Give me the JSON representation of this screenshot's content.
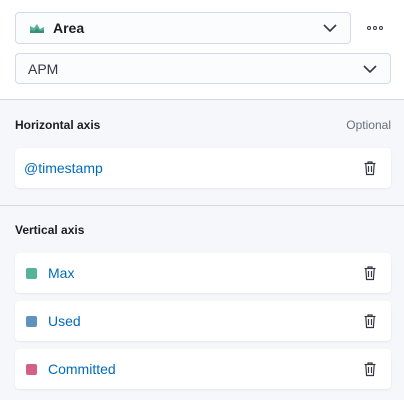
{
  "chart_type": {
    "label": "Area",
    "icon": "area-chart-icon"
  },
  "index_pattern": {
    "value": "APM"
  },
  "more_actions": {
    "icon": "more-actions-icon"
  },
  "horizontal_axis": {
    "title": "Horizontal axis",
    "optional_label": "Optional",
    "field": {
      "label": "@timestamp"
    }
  },
  "vertical_axis": {
    "title": "Vertical axis",
    "fields": [
      {
        "label": "Max",
        "color": "#54b399"
      },
      {
        "label": "Used",
        "color": "#6092c0"
      },
      {
        "label": "Committed",
        "color": "#d36086"
      }
    ]
  },
  "colors": {
    "link": "#006bb8",
    "border": "#d3dae6",
    "panel_bg": "#f5f7fa"
  }
}
